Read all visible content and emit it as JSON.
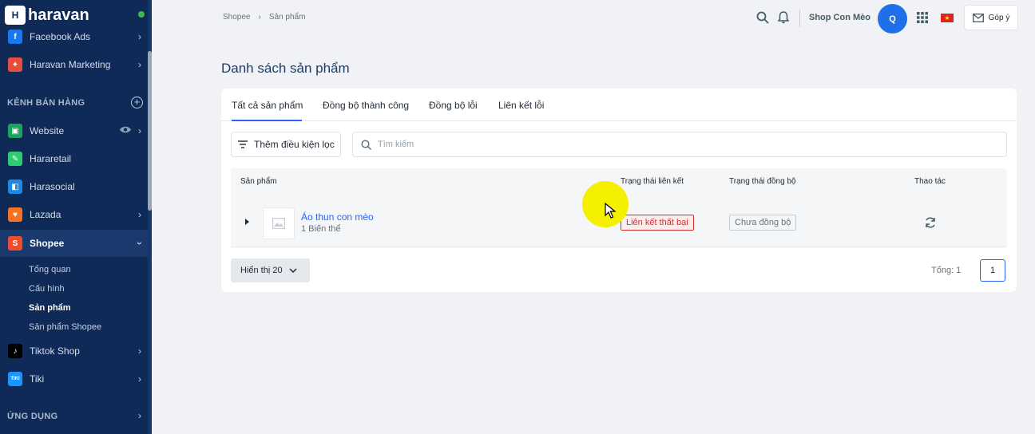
{
  "brand": {
    "name": "haravan",
    "mark": "H"
  },
  "sidebar": {
    "items_top": [
      {
        "label": "Facebook Ads",
        "icon": "facebook-icon",
        "color": "#1877f2"
      },
      {
        "label": "Haravan Marketing",
        "icon": "marketing-icon",
        "color": "#e74c3c"
      }
    ],
    "section_sales": "KÊNH BÁN HÀNG",
    "channels": [
      {
        "label": "Website",
        "icon": "website-icon",
        "color": "#1aa260"
      },
      {
        "label": "Hararetail",
        "icon": "hararetail-icon",
        "color": "#2ecc71"
      },
      {
        "label": "Harasocial",
        "icon": "harasocial-icon",
        "color": "#1e88e5"
      },
      {
        "label": "Lazada",
        "icon": "lazada-icon",
        "color": "#f57224"
      },
      {
        "label": "Shopee",
        "icon": "shopee-icon",
        "color": "#ee4d2d"
      }
    ],
    "shopee_sub": [
      "Tổng quan",
      "Cấu hình",
      "Sản phẩm",
      "Sản phẩm Shopee"
    ],
    "channels_after": [
      {
        "label": "Tiktok Shop",
        "icon": "tiktok-icon",
        "color": "#000000"
      },
      {
        "label": "Tiki",
        "icon": "tiki-icon",
        "color": "#1a94ff",
        "mark": "TIKI"
      }
    ],
    "section_apps": "ỨNG DỤNG"
  },
  "breadcrumb": {
    "parent": "Shopee",
    "sep": "›",
    "current": "Sản phẩm"
  },
  "topbar": {
    "shop_name": "Shop Con Mèo",
    "avatar_initial": "Q",
    "feedback_label": "Góp ý"
  },
  "page": {
    "title": "Danh sách sản phẩm",
    "tabs": [
      "Tất cả sản phẩm",
      "Đồng bộ thành công",
      "Đồng bộ lỗi",
      "Liên kết lỗi"
    ],
    "filter_label": "Thêm điều kiện lọc",
    "search_placeholder": "Tìm kiếm",
    "columns": [
      "Sản phẩm",
      "Trạng thái liên kết",
      "Trạng thái đồng bộ",
      "Thao tác"
    ],
    "rows": [
      {
        "name": "Áo thun con mèo",
        "variants": "1 Biến thể",
        "link_status": "Liên kết thất bại",
        "sync_status": "Chưa đồng bộ"
      }
    ],
    "per_page": "Hiển thị 20",
    "total": "Tổng: 1",
    "current_page": "1"
  },
  "colors": {
    "sidebar_bg": "#0f2a57",
    "primary": "#2962ff",
    "error": "#d32f2f",
    "highlight": "#f5ef00"
  }
}
